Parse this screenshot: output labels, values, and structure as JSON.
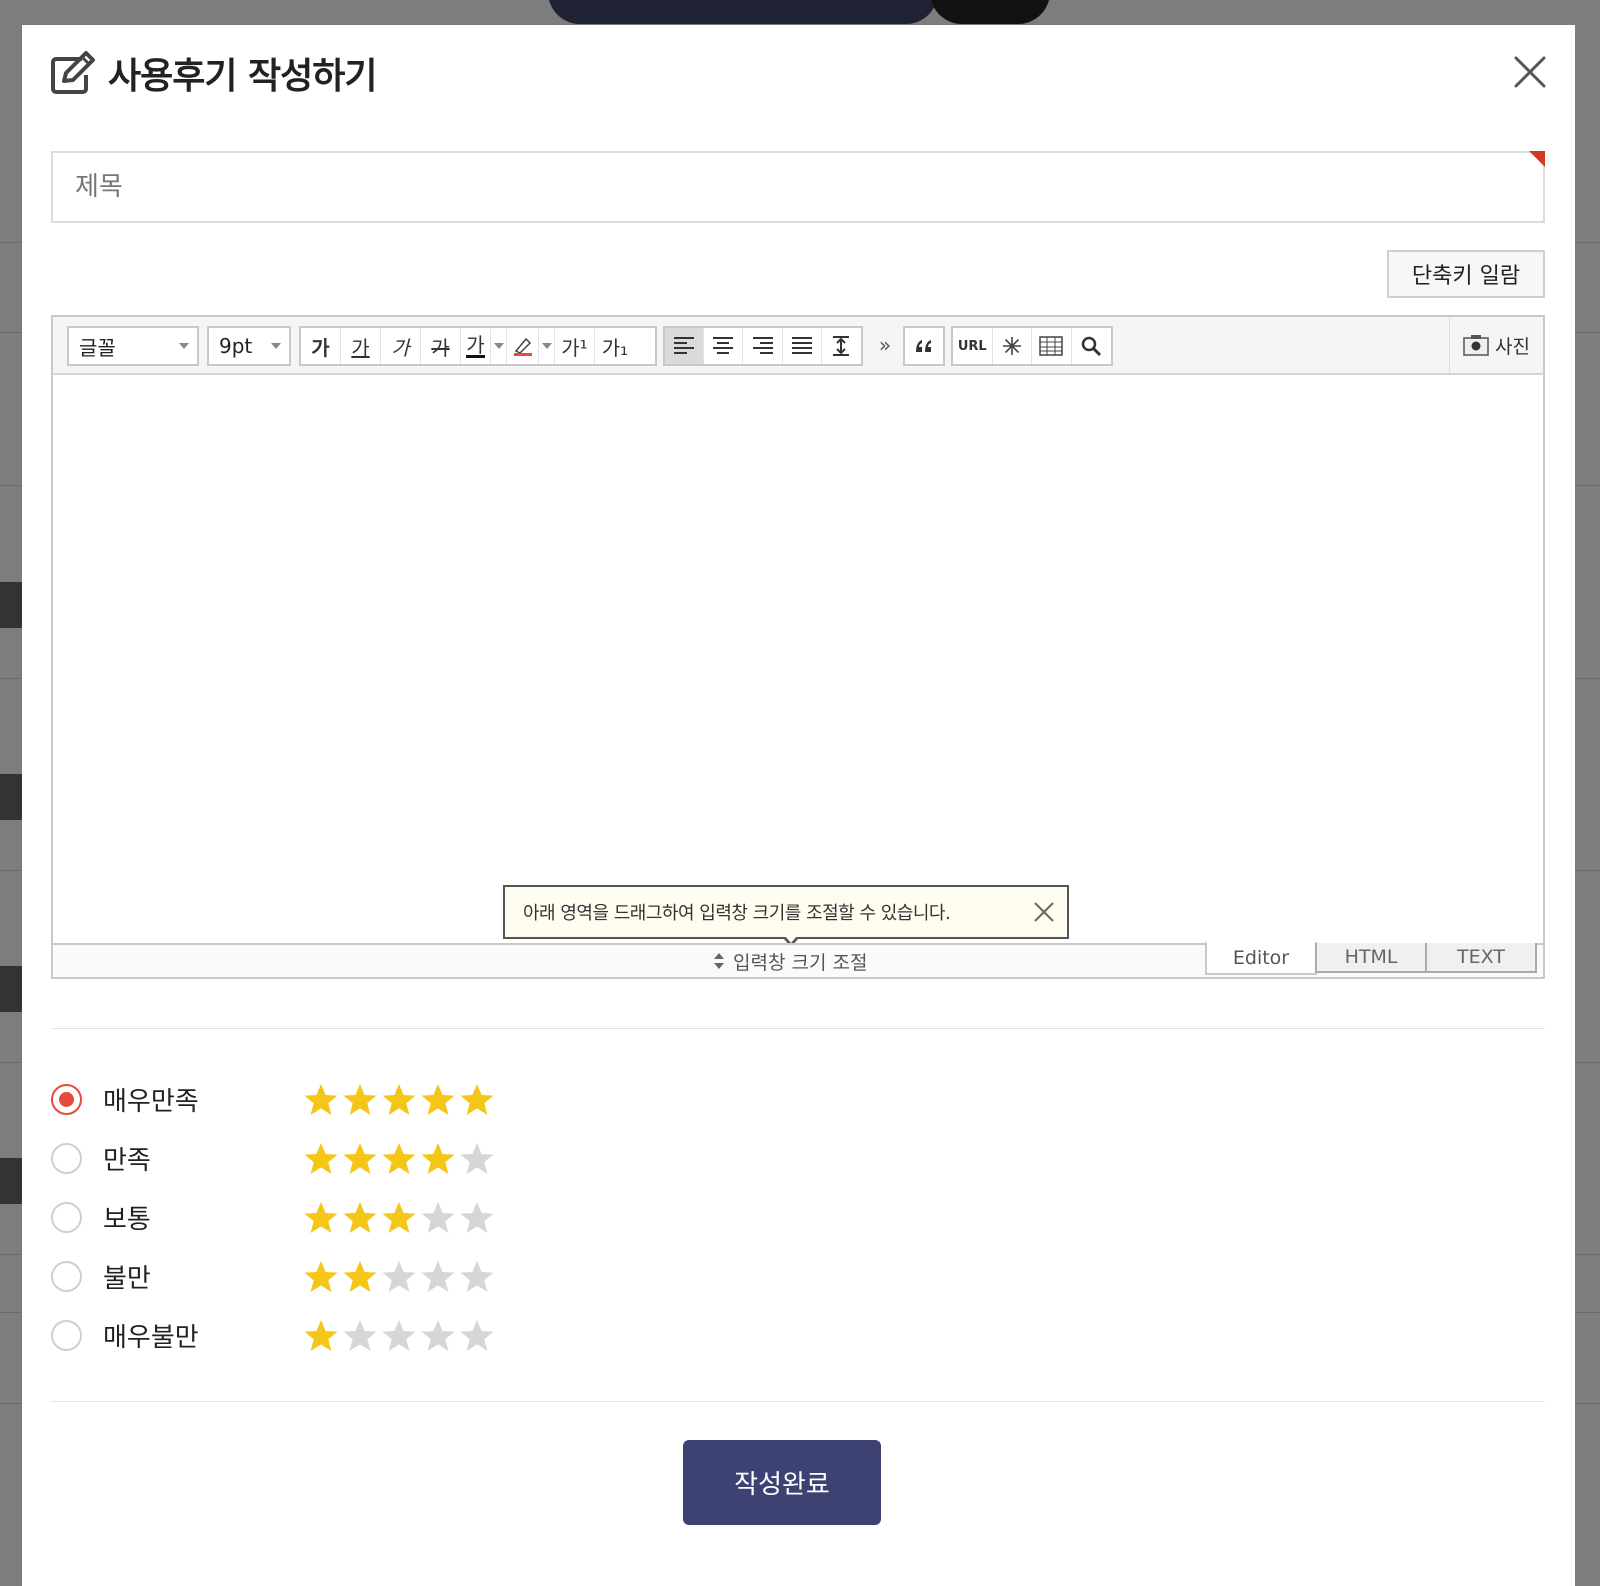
{
  "modal": {
    "title": "사용후기 작성하기",
    "subject_placeholder": "제목",
    "shortcut_label": "단축키 일람",
    "submit_label": "작성완료"
  },
  "editor": {
    "font_select": "글꼴",
    "size_select": "9pt",
    "format_buttons": [
      "가",
      "가",
      "가",
      "가",
      "가"
    ],
    "superscript": "가¹",
    "subscript": "가₁",
    "more": "»",
    "url": "URL",
    "photo_label": "사진",
    "resize_tip": "아래 영역을 드래그하여 입력창 크기를 조절할 수 있습니다.",
    "resize_label": "입력창 크기 조절",
    "modes": [
      "Editor",
      "HTML",
      "TEXT"
    ]
  },
  "rating": {
    "options": [
      {
        "label": "매우만족",
        "stars": 5,
        "selected": true
      },
      {
        "label": "만족",
        "stars": 4,
        "selected": false
      },
      {
        "label": "보통",
        "stars": 3,
        "selected": false
      },
      {
        "label": "불만",
        "stars": 2,
        "selected": false
      },
      {
        "label": "매우불만",
        "stars": 1,
        "selected": false
      }
    ]
  },
  "colors": {
    "accent_red": "#e44b3e",
    "submit_bg": "#3e4273",
    "star_on": "#f5c518",
    "star_off": "#d6d6d6"
  }
}
